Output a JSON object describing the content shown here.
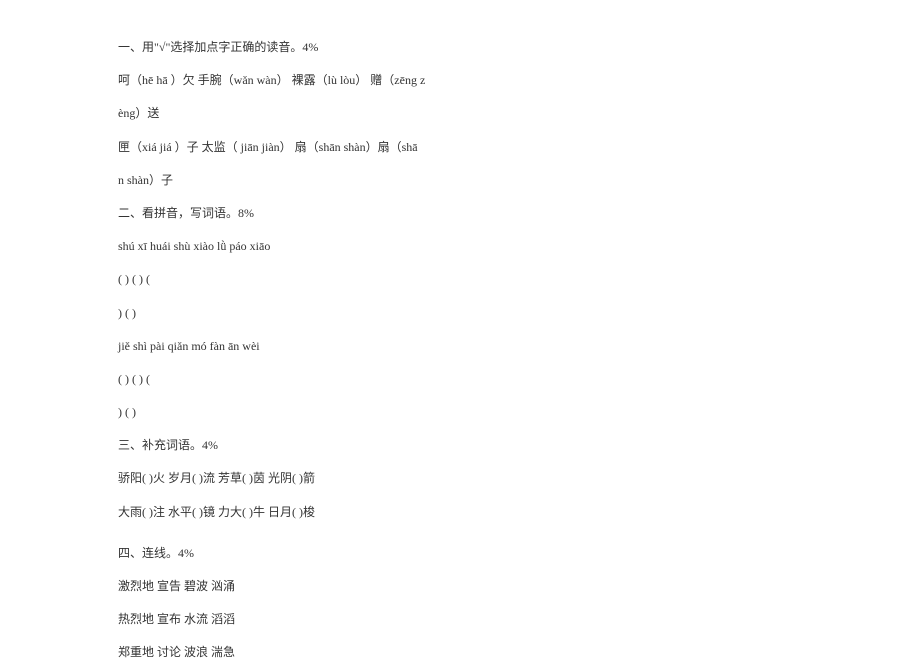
{
  "lines": {
    "l1": "一、用\"√\"选择加点字正确的读音。4%",
    "l2": "呵（hē hā ）欠        手腕（wǎn   wàn）      裸露（lù   lòu）     赠（zēng   z",
    "l3": "èng）送",
    "l4": "匣（xiá jiá ）子    太监（ jiān   jiàn）    扇（shān   shàn）扇（shā",
    "l5": "n   shàn）子",
    "l6": "二、看拼音，写词语。8%",
    "l7": "shú xī      huái shù     xiào lǜ       páo xiāo",
    "l8": "(               )       (              )           (",
    "l9": "          )         (                )",
    "l10": "jiě shì     pài qiǎn      mó fàn      ān wèi",
    "l11": "(               )       (              )           (",
    "l12": "          )         (                )",
    "l13": "三、补充词语。4%",
    "l14": "骄阳(           )火  岁月(    )流  芳草(    )茵   光阴(    )箭",
    "l15": "大雨(           )注  水平(    )镜  力大(    )牛   日月(    )梭",
    "l16": "四、连线。4%",
    "l17": "激烈地          宣告        碧波    汹涌",
    "l18": "热烈地          宣布        水流    滔滔",
    "l19": "郑重地          讨论        波浪    湍急"
  }
}
